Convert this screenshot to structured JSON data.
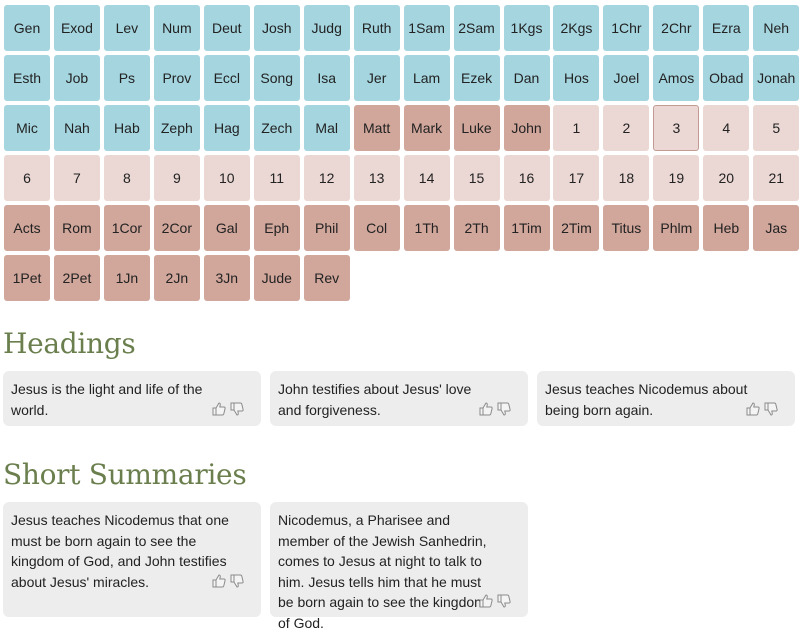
{
  "books": {
    "old_testament": [
      "Gen",
      "Exod",
      "Lev",
      "Num",
      "Deut",
      "Josh",
      "Judg",
      "Ruth",
      "1Sam",
      "2Sam",
      "1Kgs",
      "2Kgs",
      "1Chr",
      "2Chr",
      "Ezra",
      "Neh",
      "Esth",
      "Job",
      "Ps",
      "Prov",
      "Eccl",
      "Song",
      "Isa",
      "Jer",
      "Lam",
      "Ezek",
      "Dan",
      "Hos",
      "Joel",
      "Amos",
      "Obad",
      "Jonah",
      "Mic",
      "Nah",
      "Hab",
      "Zeph",
      "Hag",
      "Zech",
      "Mal"
    ],
    "gospels": [
      "Matt",
      "Mark",
      "Luke",
      "John"
    ],
    "chapters": [
      "1",
      "2",
      "3",
      "4",
      "5",
      "6",
      "7",
      "8",
      "9",
      "10",
      "11",
      "12",
      "13",
      "14",
      "15",
      "16",
      "17",
      "18",
      "19",
      "20",
      "21"
    ],
    "selected_chapter": "3",
    "rest_new_testament": [
      "Acts",
      "Rom",
      "1Cor",
      "2Cor",
      "Gal",
      "Eph",
      "Phil",
      "Col",
      "1Th",
      "2Th",
      "1Tim",
      "2Tim",
      "Titus",
      "Phlm",
      "Heb",
      "Jas",
      "1Pet",
      "2Pet",
      "1Jn",
      "2Jn",
      "3Jn",
      "Jude",
      "Rev"
    ]
  },
  "colors": {
    "old_testament": "#a5d6e0",
    "new_testament": "#d1a69b",
    "chapter": "#ebd8d4",
    "section_heading": "#6b7f4e",
    "card_bg": "#ededed"
  },
  "headings_section": {
    "title": "Headings",
    "cards": [
      {
        "text": "Jesus is the light and life of the world."
      },
      {
        "text": "John testifies about Jesus' love and forgiveness."
      },
      {
        "text": "Jesus teaches Nicodemus about being born again."
      }
    ]
  },
  "summaries_section": {
    "title": "Short Summaries",
    "cards": [
      {
        "text": "Jesus teaches Nicodemus that one must be born again to see the kingdom of God, and John testifies about Jesus' miracles."
      },
      {
        "text": "Nicodemus, a Pharisee and member of the Jewish Sanhedrin, comes to Jesus at night to talk to him. Jesus tells him that he must be born again to see the kingdom of God."
      }
    ]
  },
  "icons": {
    "thumbs_up": "thumbs-up-icon",
    "thumbs_down": "thumbs-down-icon"
  }
}
